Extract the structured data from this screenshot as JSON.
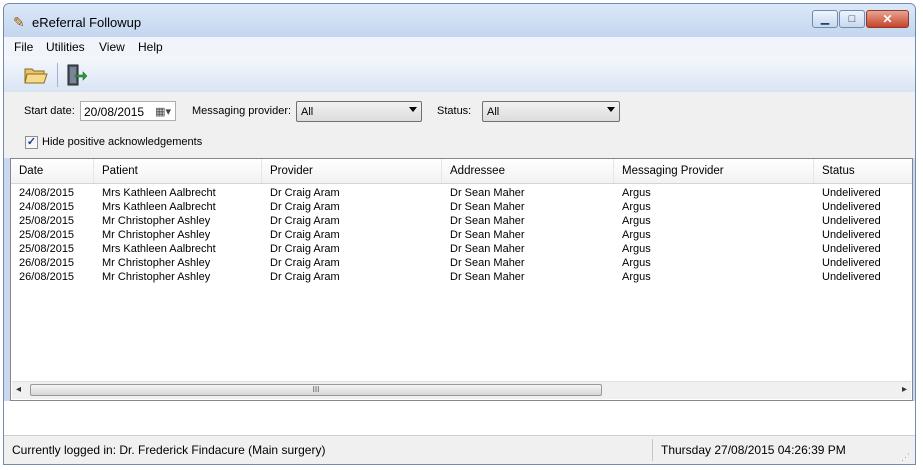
{
  "window": {
    "title": "eReferral Followup",
    "minimize_icon": "minimize-icon",
    "maximize_icon": "maximize-icon",
    "close_icon": "close-icon"
  },
  "menu": [
    "File",
    "Utilities",
    "View",
    "Help"
  ],
  "toolbar": {
    "open_icon": "open-folder-icon",
    "exit_icon": "exit-door-icon"
  },
  "filters": {
    "start_date_label": "Start date:",
    "start_date_value": "20/08/2015",
    "messaging_provider_label": "Messaging provider:",
    "messaging_provider_value": "All",
    "status_label": "Status:",
    "status_value": "All",
    "hide_positive_label": "Hide positive acknowledgements",
    "hide_positive_checked": true
  },
  "grid": {
    "columns": [
      "Date",
      "Patient",
      "Provider",
      "Addressee",
      "Messaging Provider",
      "Status"
    ],
    "rows": [
      [
        "24/08/2015",
        "Mrs Kathleen Aalbrecht",
        "Dr Craig Aram",
        "Dr Sean Maher",
        "Argus",
        "Undelivered"
      ],
      [
        "24/08/2015",
        "Mrs Kathleen Aalbrecht",
        "Dr Craig Aram",
        "Dr Sean Maher",
        "Argus",
        "Undelivered"
      ],
      [
        "25/08/2015",
        "Mr Christopher Ashley",
        "Dr Craig Aram",
        "Dr Sean Maher",
        "Argus",
        "Undelivered"
      ],
      [
        "25/08/2015",
        "Mr Christopher Ashley",
        "Dr Craig Aram",
        "Dr Sean Maher",
        "Argus",
        "Undelivered"
      ],
      [
        "25/08/2015",
        "Mrs Kathleen Aalbrecht",
        "Dr Craig Aram",
        "Dr Sean Maher",
        "Argus",
        "Undelivered"
      ],
      [
        "26/08/2015",
        "Mr Christopher Ashley",
        "Dr Craig Aram",
        "Dr Sean Maher",
        "Argus",
        "Undelivered"
      ],
      [
        "26/08/2015",
        "Mr Christopher Ashley",
        "Dr Craig Aram",
        "Dr Sean Maher",
        "Argus",
        "Undelivered"
      ]
    ],
    "scroll_thumb_grip": "III"
  },
  "status": {
    "logged_in": "Currently logged in:  Dr. Frederick Findacure (Main surgery)",
    "datetime": "Thursday 27/08/2015 04:26:39 PM"
  }
}
